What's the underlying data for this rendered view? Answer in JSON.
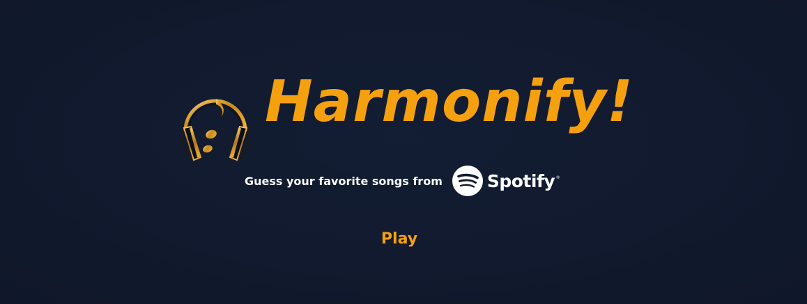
{
  "app": {
    "title": "Harmonify!",
    "logo_icon": "headphones-music-note-icon"
  },
  "tagline": {
    "text": "Guess your favorite songs from",
    "brand": "Spotify",
    "brand_mark": "®",
    "brand_icon": "spotify-icon"
  },
  "actions": {
    "play_label": "Play"
  },
  "colors": {
    "background": "#111a2e",
    "accent": "#f5a00f",
    "text": "#ffffff"
  }
}
